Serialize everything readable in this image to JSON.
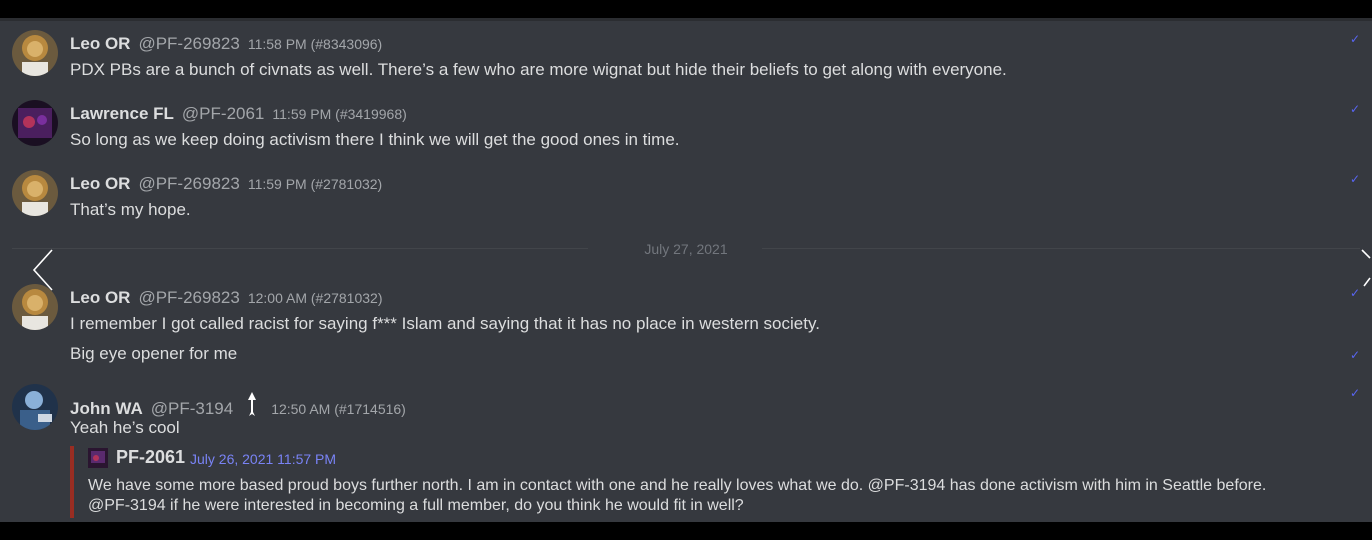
{
  "messages": [
    {
      "user": "Leo OR",
      "handle": "@PF-269823",
      "time": "11:58 PM (#8343096)",
      "text": "PDX PBs are a bunch of civnats as well. There’s a few who are more wignat but hide their beliefs to get along with everyone."
    },
    {
      "user": "Lawrence FL",
      "handle": "@PF-2061",
      "time": "11:59 PM (#3419968)",
      "text": "So long as we keep doing activism there I think we will get the good ones in time."
    },
    {
      "user": "Leo OR",
      "handle": "@PF-269823",
      "time": "11:59 PM (#2781032)",
      "text": "That’s my hope."
    },
    {
      "user": "Leo OR",
      "handle": "@PF-269823",
      "time": "12:00 AM (#2781032)",
      "text": "I remember I got called racist for saying f*** Islam and saying that it has no place in western society.",
      "followup": "Big eye opener for me"
    },
    {
      "user": "John WA",
      "handle": "@PF-3194",
      "time": "12:50 AM (#1714516)",
      "text": "Yeah he’s cool"
    }
  ],
  "divider": {
    "date": "July 27, 2021"
  },
  "reply_quote": {
    "user": "PF-2061",
    "date": "July 26, 2021 11:57 PM",
    "text": "We have some more based proud boys further north. I am in contact with one and he really loves what we do. @PF-3194 has done activism with him in Seattle before. @PF-3194 if he were interested in becoming a full member, do you think he would fit in well?"
  },
  "icons": {
    "read_check": "checkmark-icon",
    "nav_prev": "chevron-left-icon",
    "nav_next": "chevron-right-icon",
    "role": "arrow-role-icon"
  },
  "colors": {
    "background": "#36393f",
    "text": "#dcddde",
    "muted": "#a3a6aa",
    "accent": "#5865f2",
    "quote_bar": "#992d22",
    "link_date": "#7983f5"
  }
}
